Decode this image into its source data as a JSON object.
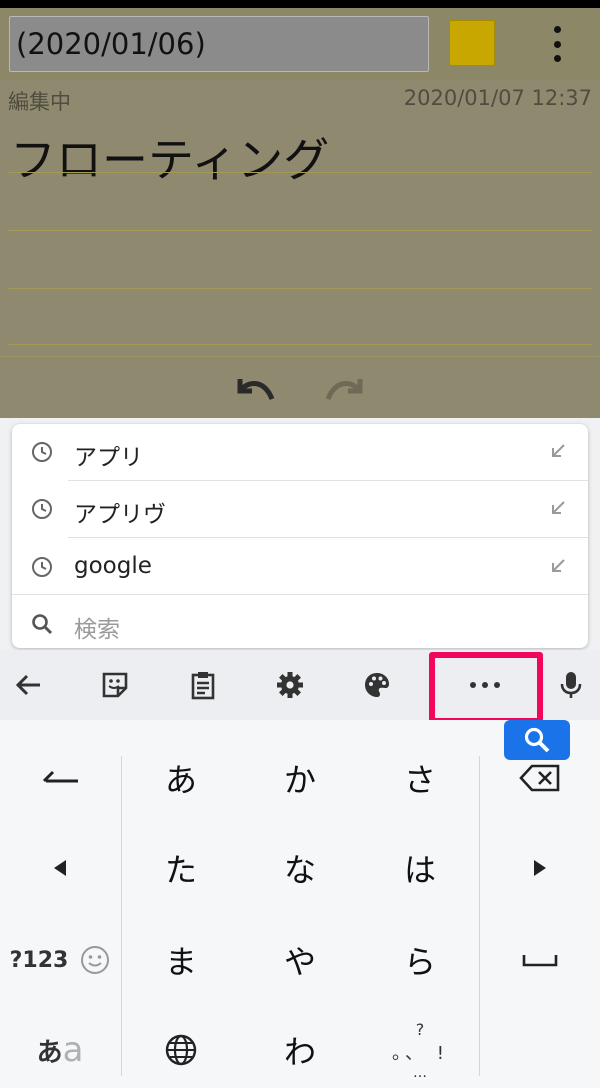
{
  "note": {
    "title": "(2020/01/06)",
    "status": "編集中",
    "timestamp": "2020/01/07 12:37",
    "body": "フローティング",
    "swatch_color": "#c8a800"
  },
  "suggestions": [
    {
      "label": "アプリ",
      "icon": "clock-icon"
    },
    {
      "label": "アプリヴ",
      "icon": "clock-icon"
    },
    {
      "label": "google",
      "icon": "clock-icon"
    }
  ],
  "search": {
    "placeholder": "検索",
    "icon": "search-icon"
  },
  "toolbar": {
    "icons": [
      "back-arrow-icon",
      "sticker-icon",
      "clipboard-icon",
      "gear-icon",
      "palette-icon",
      "more-icon",
      "mic-icon"
    ],
    "highlight_color": "#f2075a"
  },
  "keyboard": {
    "rows": [
      [
        "あ",
        "か",
        "さ"
      ],
      [
        "た",
        "な",
        "は"
      ],
      [
        "ま",
        "や",
        "ら"
      ],
      [
        "わ",
        "",
        ""
      ]
    ],
    "numbers_label": "?123",
    "kana_label_a": "あ",
    "kana_label_b": "a",
    "punct_top": "?",
    "punct_mid": "。、 !",
    "punct_bottom": "…",
    "accent_color": "#1a73e8"
  }
}
